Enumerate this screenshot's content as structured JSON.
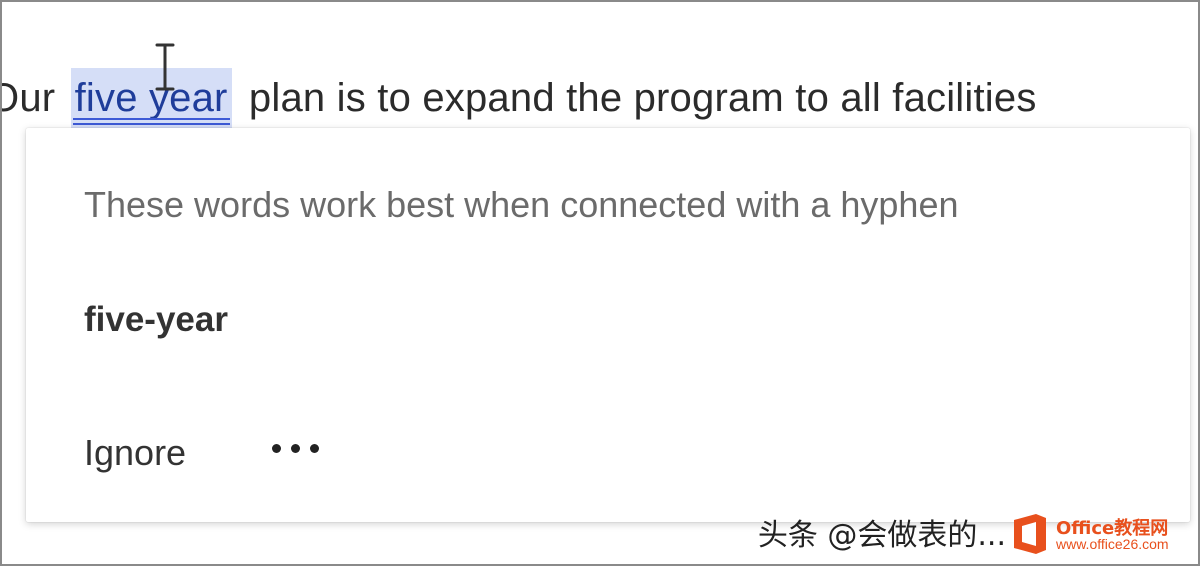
{
  "document": {
    "sentence_start": "Our",
    "flagged_phrase": "five year",
    "sentence_rest": "plan is to expand the program to all facilities"
  },
  "suggestion_card": {
    "description": "These words work best when connected with a hyphen",
    "suggestion": "five-year",
    "ignore_label": "Ignore",
    "more_options_icon": "ellipsis-icon"
  },
  "watermark": {
    "caption": "头条 @会做表的...",
    "brand_name": "Office教程网",
    "brand_url": "www.office26.com",
    "brand_color": "#e8501d"
  },
  "colors": {
    "highlight": "#d5def7",
    "underline": "#3d5ad6",
    "text": "#2b2b2b",
    "muted_text": "#6b6b6b"
  }
}
